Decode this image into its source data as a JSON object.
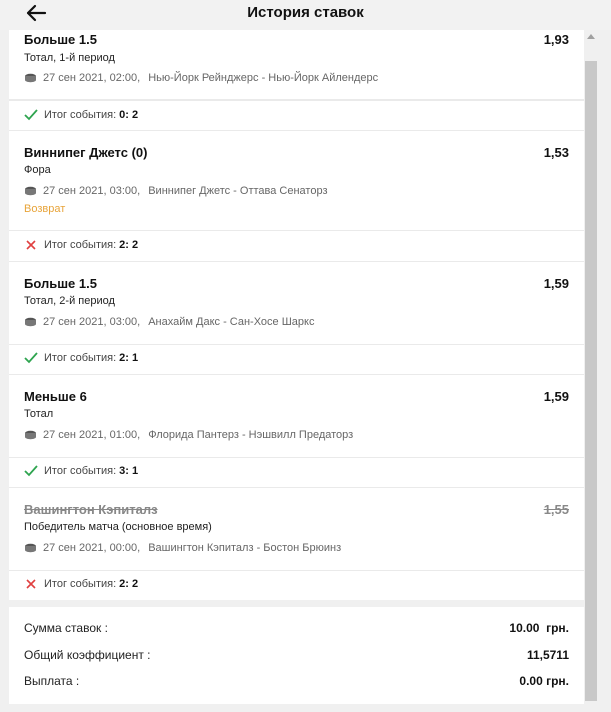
{
  "header": {
    "title": "История ставок"
  },
  "bets": [
    {
      "name": "Больше 1.5",
      "odds": "1,93",
      "type": "Тотал, 1-й период",
      "date": "27 сен 2021, 02:00,",
      "match": "Нью-Йорк Рейнджерс - Нью-Йорк Айлендерс",
      "result_label": "Итог события:",
      "score": "0: 2",
      "outcome": "won"
    },
    {
      "name": "Виннипег Джетс (0)",
      "odds": "1,53",
      "type": "Фора",
      "date": "27 сен 2021, 03:00,",
      "match": "Виннипег Джетс - Оттава Сенаторз",
      "status": "Возврат",
      "result_label": "Итог события:",
      "score": "2: 2",
      "outcome": "lost"
    },
    {
      "name": "Больше 1.5",
      "odds": "1,59",
      "type": "Тотал, 2-й период",
      "date": "27 сен 2021, 03:00,",
      "match": "Анахайм Дакс - Сан-Хосе Шаркс",
      "result_label": "Итог события:",
      "score": "2: 1",
      "outcome": "won"
    },
    {
      "name": "Меньше 6",
      "odds": "1,59",
      "type": "Тотал",
      "date": "27 сен 2021, 01:00,",
      "match": "Флорида Пантерз - Нэшвилл Предаторз",
      "result_label": "Итог события:",
      "score": "3: 1",
      "outcome": "won"
    },
    {
      "name": "Вашингтон Кэпиталз",
      "odds": "1,55",
      "type": "Победитель матча (основное время)",
      "date": "27 сен 2021, 00:00,",
      "match": "Вашингтон Кэпиталз - Бостон Брюинз",
      "result_label": "Итог события:",
      "score": "2: 2",
      "outcome": "lost",
      "struck": true
    }
  ],
  "summary": {
    "stake_label": "Сумма ставок :",
    "stake_value": "10.00  грн.",
    "coef_label": "Общий коэффициент :",
    "coef_value": "11,5711",
    "payout_label": "Выплата :",
    "payout_value": "0.00 грн."
  },
  "colors": {
    "won": "#2ea44f",
    "lost": "#e04040",
    "refund": "#e8a43a"
  }
}
